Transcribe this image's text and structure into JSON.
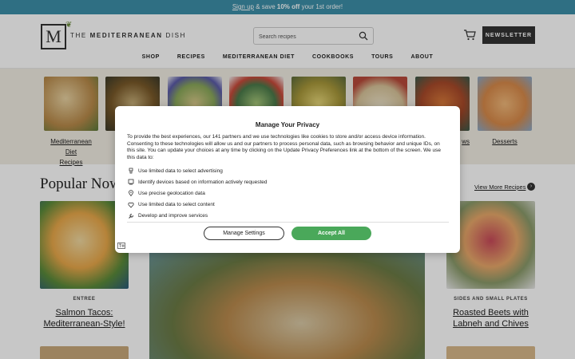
{
  "promo": {
    "link": "Sign up",
    "text_a": " & save ",
    "bold": "10% off",
    "text_b": " your 1st order!"
  },
  "logo": {
    "letter": "M",
    "text_light": "THE ",
    "text_bold": "MEDITERRANEAN",
    "text_end": " DISH"
  },
  "search": {
    "placeholder": "Search recipes",
    "icon": "search-icon"
  },
  "header": {
    "newsletter_label": "NEWSLETTER",
    "cart_icon": "cart-icon"
  },
  "nav": {
    "items": [
      "SHOP",
      "RECIPES",
      "MEDITERRANEAN DIET",
      "COOKBOOKS",
      "TOURS",
      "ABOUT"
    ]
  },
  "categories": [
    {
      "label_line1": "Mediterranean Diet",
      "label_line2": "Recipes",
      "color": "#c8a36a"
    },
    {
      "label_line1": "",
      "label_line2": "",
      "color": "#8a6a3a"
    },
    {
      "label_line1": "",
      "label_line2": "",
      "color": "#9aa86a"
    },
    {
      "label_line1": "",
      "label_line2": "",
      "color": "#6a8a5a"
    },
    {
      "label_line1": "",
      "label_line2": "",
      "color": "#b0a04a"
    },
    {
      "label_line1": "",
      "label_line2": "",
      "color": "#d8c49a"
    },
    {
      "label_line1": "ws",
      "label_line2": "",
      "color": "#b86a3a"
    },
    {
      "label_line1": "Desserts",
      "label_line2": "",
      "color": "#d89a5a"
    }
  ],
  "popular": {
    "title": "Popular Now",
    "view_more": "View More Recipes",
    "arrow": "›"
  },
  "cards": [
    {
      "tag": "ENTREE",
      "title": "Salmon Tacos:",
      "title2": "Mediterranean-Style!"
    },
    {
      "tag": "SIDES AND SMALL PLATES",
      "title": "Roasted Beets with",
      "title2": "Labneh and Chives"
    }
  ],
  "privacy": {
    "title": "Manage Your Privacy",
    "body": "To provide the best experiences, our 141 partners and we use technologies like cookies to store and/or access device information. Consenting to these technologies will allow us and our partners to process personal data, such as browsing behavior and unique IDs, on this site. You can update your choices at any time by clicking on the Update Privacy Preferences link at the bottom of the screen. We use this data to:",
    "purposes": [
      {
        "label": "Use limited data to select advertising",
        "icon": "ad-icon"
      },
      {
        "label": "Identify devices based on information actively requested",
        "icon": "device-icon"
      },
      {
        "label": "Use precise geolocation data",
        "icon": "location-pin-icon"
      },
      {
        "label": "Use limited data to select content",
        "icon": "heart-icon"
      },
      {
        "label": "Develop and improve services",
        "icon": "wrench-icon"
      }
    ],
    "manage_label": "Manage Settings",
    "accept_label": "Accept All",
    "accent": "#4aa85a"
  }
}
